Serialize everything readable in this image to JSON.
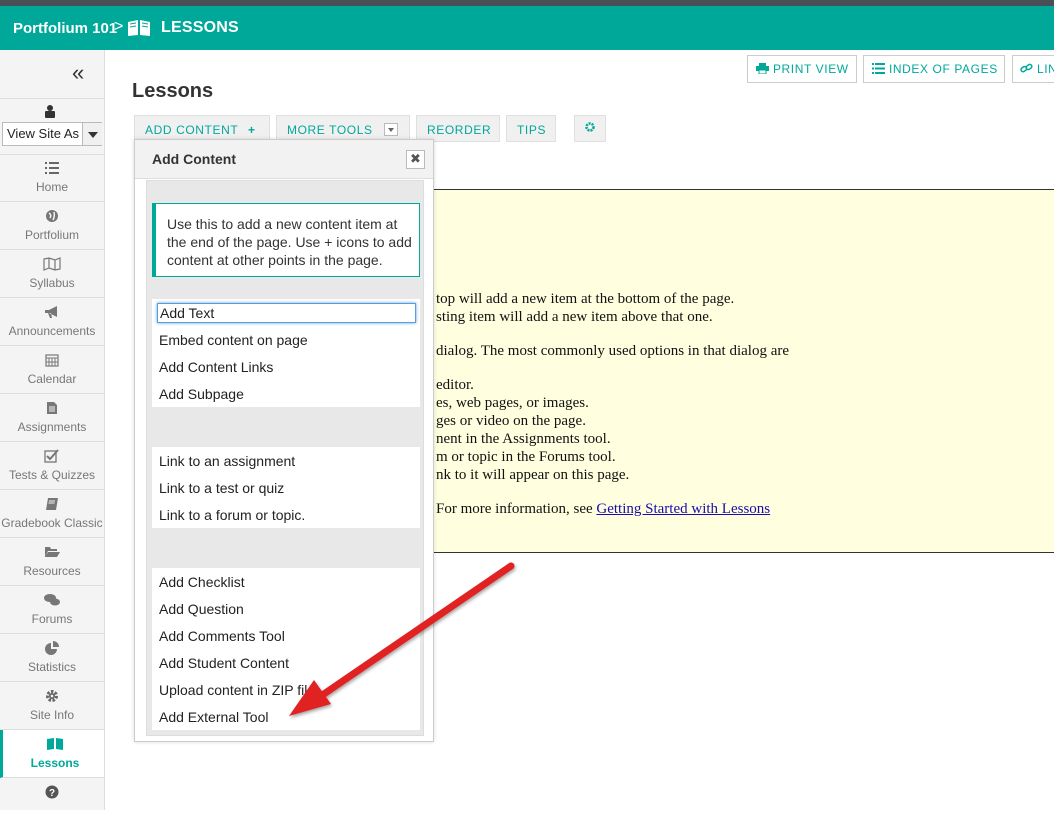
{
  "header": {
    "site": "Portfolium 101",
    "separator": ">",
    "tool": "LESSONS"
  },
  "sidebar": {
    "view_as": "View Site As",
    "items": [
      {
        "label": "Home",
        "icon": "list-icon"
      },
      {
        "label": "Portfolium",
        "icon": "globe-icon"
      },
      {
        "label": "Syllabus",
        "icon": "map-icon"
      },
      {
        "label": "Announcements",
        "icon": "bullhorn-icon"
      },
      {
        "label": "Calendar",
        "icon": "calendar-icon"
      },
      {
        "label": "Assignments",
        "icon": "document-icon"
      },
      {
        "label": "Tests & Quizzes",
        "icon": "checkbox-icon"
      },
      {
        "label": "Gradebook Classic",
        "icon": "book-icon"
      },
      {
        "label": "Resources",
        "icon": "folder-icon"
      },
      {
        "label": "Forums",
        "icon": "chat-icon"
      },
      {
        "label": "Statistics",
        "icon": "pie-chart-icon"
      },
      {
        "label": "Site Info",
        "icon": "gear-icon"
      },
      {
        "label": "Lessons",
        "icon": "book-open-icon"
      }
    ]
  },
  "toolbar": {
    "print_view": "PRINT VIEW",
    "index_of_pages": "INDEX OF PAGES",
    "link": "LIN",
    "add_content": "ADD CONTENT",
    "more_tools": "MORE TOOLS",
    "reorder": "REORDER",
    "tips": "TIPS"
  },
  "page_title": "Lessons",
  "dialog": {
    "title": "Add Content",
    "info": "Use this to add a new content item at the end of the page. Use + icons to add content at other points in the page.",
    "group1": [
      "Add Text",
      "Embed content on page",
      "Add Content Links",
      "Add Subpage"
    ],
    "group2": [
      "Link to an assignment",
      "Link to a test or quiz",
      "Link to a forum or topic."
    ],
    "group3": [
      "Add Checklist",
      "Add Question",
      "Add Comments Tool",
      "Add Student Content",
      "Upload content in ZIP file",
      "Add External Tool"
    ]
  },
  "content": {
    "lines": [
      "top will add a new item at the bottom of the page.",
      "sting item will add a new item above that one.",
      "dialog. The most commonly used options in that dialog are",
      "editor.",
      "es, web pages, or images.",
      "ges or video on the page.",
      "nent in the Assignments tool.",
      "m or topic in the Forums tool.",
      "nk to it will appear on this page."
    ],
    "more_info": "For more information, see ",
    "link": "Getting Started with Lessons"
  },
  "colors": {
    "accent": "#00a89a",
    "content_bg": "#ffffe0",
    "arrow": "#e02020"
  }
}
